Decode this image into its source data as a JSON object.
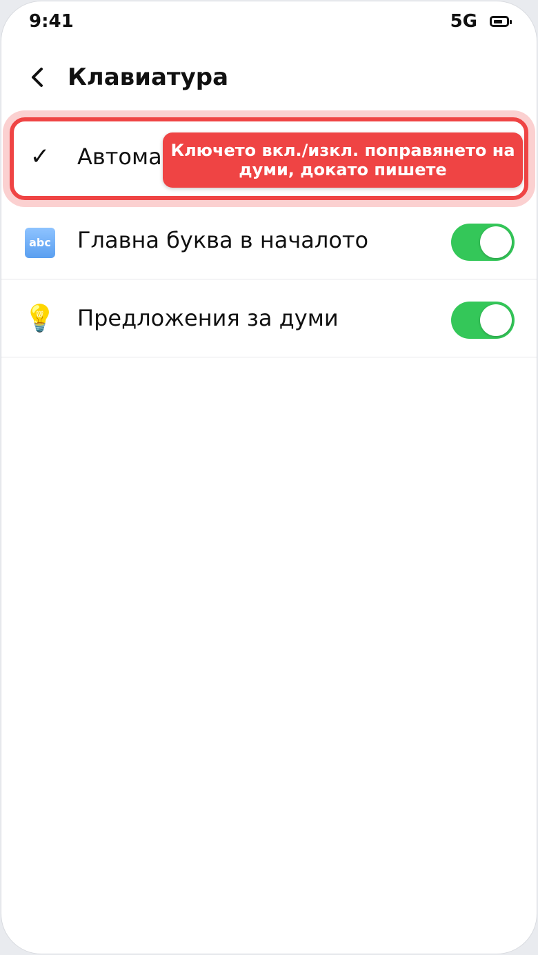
{
  "status_bar": {
    "time": "9:41",
    "network": "5G",
    "battery_icon": "battery-icon"
  },
  "header": {
    "back_icon": "chevron-left-icon",
    "title": "Клавиатура"
  },
  "rows": [
    {
      "icon": "checkmark-icon",
      "icon_glyph": "✓",
      "label": "Автома"
    },
    {
      "icon": "abc-icon",
      "icon_glyph": "abc",
      "label": "Главна буква в началото",
      "toggle_on": true
    },
    {
      "icon": "lightbulb-icon",
      "icon_glyph": "💡",
      "label": "Предложения за думи",
      "toggle_on": true
    }
  ],
  "tooltip": {
    "text": "Ключето вкл./изкл. поправянето на думи, докато пишете"
  },
  "colors": {
    "accent_red": "#ef4444",
    "toggle_green": "#34c759"
  }
}
